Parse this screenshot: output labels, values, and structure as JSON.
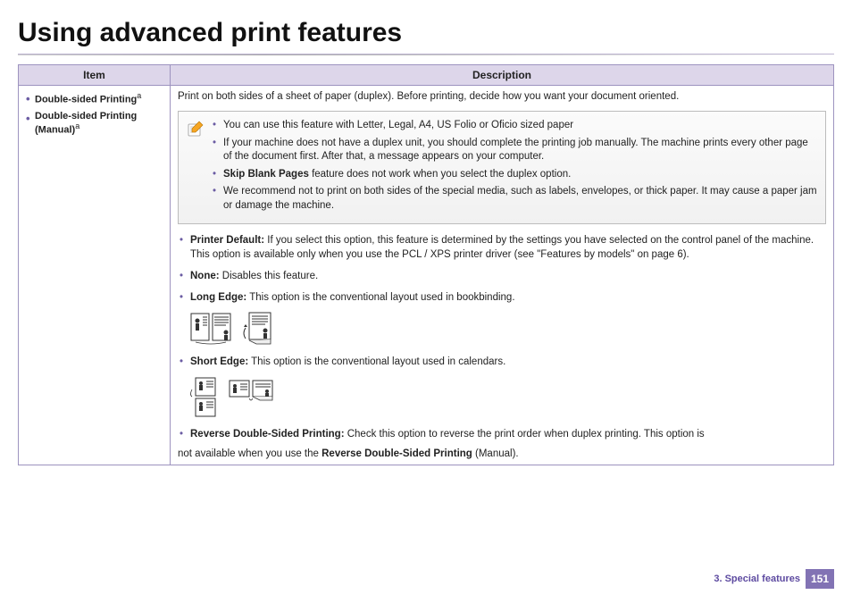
{
  "page_title": "Using advanced print features",
  "table": {
    "headers": {
      "item": "Item",
      "description": "Description"
    },
    "items": [
      {
        "label": "Double-sided Printing",
        "sup": "a"
      },
      {
        "label": "Double-sided Printing (Manual)",
        "sup": "a"
      }
    ],
    "description_intro": "Print on both sides of a sheet of paper (duplex). Before printing, decide how you want your document oriented.",
    "notes": [
      {
        "text": "You can use this feature with Letter, Legal, A4, US Folio or Oficio sized paper"
      },
      {
        "text": "If your machine does not have a duplex unit, you should complete the printing job manually. The machine prints every other page of the document first. After that, a message appears on your computer."
      },
      {
        "bold": "Skip Blank Pages",
        "text": " feature does not work when you select the duplex option."
      },
      {
        "text": "We recommend not to print on both sides of the special media, such as labels, envelopes, or thick paper. It may cause a paper jam or damage the machine."
      }
    ],
    "options": [
      {
        "bold": "Printer Default:",
        "text": " If you select this option, this feature is determined by the settings you have selected on the control panel of the machine. This option is available only when you use the PCL / XPS printer driver (see \"Features by models\" on page 6)."
      },
      {
        "bold": "None:",
        "text": " Disables this feature."
      },
      {
        "bold": "Long Edge:",
        "text": " This option is the conventional layout used in bookbinding."
      },
      {
        "bold": "Short Edge:",
        "text": " This option is the conventional layout used in calendars."
      },
      {
        "bold": "Reverse Double-Sided Printing:",
        "text": " Check this option to reverse the print order when duplex printing. This option is"
      }
    ],
    "continuation_pre": "not available when you use the ",
    "continuation_bold": "Reverse Double-Sided Printing",
    "continuation_post": " (Manual)."
  },
  "footer": {
    "section": "3.  Special features",
    "page": "151"
  }
}
